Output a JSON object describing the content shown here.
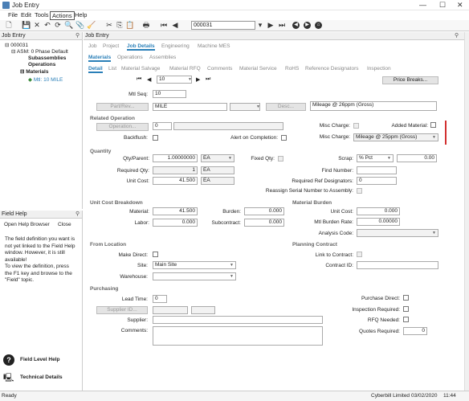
{
  "window": {
    "title": "Job Entry",
    "min": "—",
    "max": "☐",
    "close": "✕"
  },
  "menu": [
    "File",
    "Edit",
    "Tools",
    "Actions",
    "Help"
  ],
  "toolbar": {
    "record": "000031"
  },
  "tree": {
    "header": "Job Entry",
    "job": "000031",
    "asm": "ASM: 0 Phase Default",
    "subassemblies": "Subassemblies",
    "operations": "Operations",
    "materials": "Materials",
    "mtl": "Mtl: 10 MILE"
  },
  "fieldHelp": {
    "header": "Field Help",
    "open_browser": "Open Help Browser",
    "close": "Close",
    "text": "The field definition you want is not yet linked to the Field Help window. However, it is still available!\nTo view the definition, press the F1 key and browse to the \"Field\" topic.",
    "level_help": "Field Level Help",
    "tech_details": "Technical Details"
  },
  "main": {
    "header": "Job Entry",
    "tabs1": [
      "Job",
      "Project",
      "Job Details",
      "Engineering",
      "Machine MES"
    ],
    "tabs2": [
      "Materials",
      "Operations",
      "Assemblies"
    ],
    "tabs3": [
      "Detail",
      "List",
      "Material Salvage",
      "Material RFQ",
      "Comments",
      "Material Service",
      "RoHS",
      "Reference Designators",
      "Inspection"
    ],
    "nav_value": "10",
    "price_breaks": "Price Breaks...",
    "mtl_seq_label": "Mtl Seq:",
    "mtl_seq": "10",
    "part_rev_btn": "Part/Rev...",
    "part": "MILE",
    "desc_btn": "Desc...",
    "desc": "Mileage @ 26ppm (Gross)",
    "related_op": "Related Operation",
    "operation_btn": "Operation...",
    "operation_val": "0",
    "backflush": "Backflush:",
    "alert_completion": "Alert on Completion:",
    "misc_charge_label": "Misc Charge:",
    "added_material": "Added Material:",
    "misc_charge2_label": "Misc Charge:",
    "misc_charge_val": "Mileage @ 25ppm (Gross)",
    "quantity": "Quantity",
    "qty_parent_label": "Qty/Parent:",
    "qty_parent": "1.00000000",
    "qty_parent_uom": "EA",
    "fixed_qty": "Fixed Qty:",
    "scrap_label": "Scrap:",
    "scrap_type": "% Pct",
    "scrap_val": "0.00",
    "required_qty_label": "Required Qty:",
    "required_qty": "1",
    "required_uom": "EA",
    "find_number": "Find Number:",
    "unit_cost_label": "Unit Cost:",
    "unit_cost": "41.500",
    "unit_cost_uom": "EA",
    "req_ref_label": "Required Ref Designators:",
    "req_ref": "0",
    "reassign": "Reassign Serial Number to Assembly:",
    "ucb": "Unit Cost Breakdown",
    "material_label": "Material:",
    "material": "41.500",
    "burden_label": "Burden:",
    "burden": "0.000",
    "labor_label": "Labor:",
    "labor": "0.000",
    "subcontract_label": "Subcontract:",
    "subcontract": "0.000",
    "mtl_burden": "Material Burden",
    "mb_unit_cost_label": "Unit Cost:",
    "mb_unit_cost": "0.000",
    "mtl_burden_rate_label": "Mtl Burden Rate:",
    "mtl_burden_rate": "0.00000",
    "analysis_code": "Analysis Code:",
    "from_location": "From Location",
    "make_direct": "Make Direct:",
    "site_label": "Site:",
    "site": "Main Site",
    "warehouse": "Warehouse:",
    "planning_contract": "Planning Contract",
    "link_contract": "Link to Contract:",
    "contract_id": "Contract ID:",
    "purchasing": "Purchasing",
    "lead_time_label": "Lead Time:",
    "lead_time": "0",
    "supplier_btn": "Supplier ID...",
    "supplier": "Supplier:",
    "comments": "Comments:",
    "purchase_direct": "Purchase Direct:",
    "inspection_required": "Inspection Required:",
    "rfq_needed": "RFQ Needed:",
    "quotes_required_label": "Quotes Required:",
    "quotes_required": "0"
  },
  "status": {
    "left": "Ready",
    "company": "Cyberbill Limited",
    "date": "03/02/2020",
    "time": "11:44"
  }
}
